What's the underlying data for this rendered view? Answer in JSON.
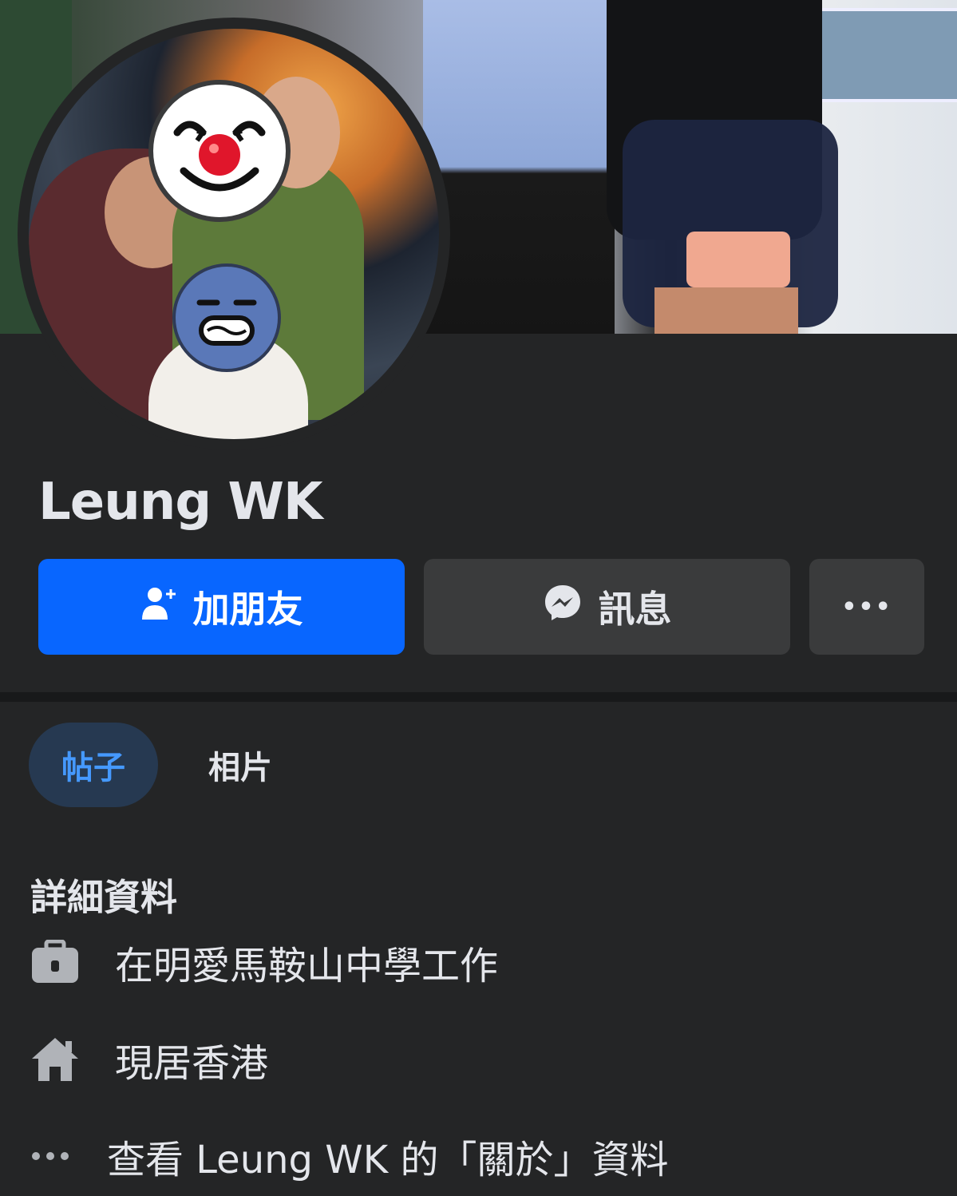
{
  "profile": {
    "name": "Leung WK"
  },
  "actions": {
    "add_friend_label": "加朋友",
    "message_label": "訊息",
    "more_label": "•••"
  },
  "tabs": [
    {
      "label": "帖子",
      "active": true
    },
    {
      "label": "相片",
      "active": false
    }
  ],
  "details": {
    "title": "詳細資料",
    "items": [
      {
        "icon": "briefcase-icon",
        "text": "在明愛馬鞍山中學工作"
      },
      {
        "icon": "home-icon",
        "text": "現居香港"
      },
      {
        "icon": "more-dots-icon",
        "text": "查看 Leung WK 的「關於」資料"
      }
    ]
  },
  "colors": {
    "background": "#242526",
    "primary_button": "#0866ff",
    "secondary_button": "#3a3b3c",
    "active_tab_bg": "#263951",
    "active_tab_text": "#4599ff"
  }
}
